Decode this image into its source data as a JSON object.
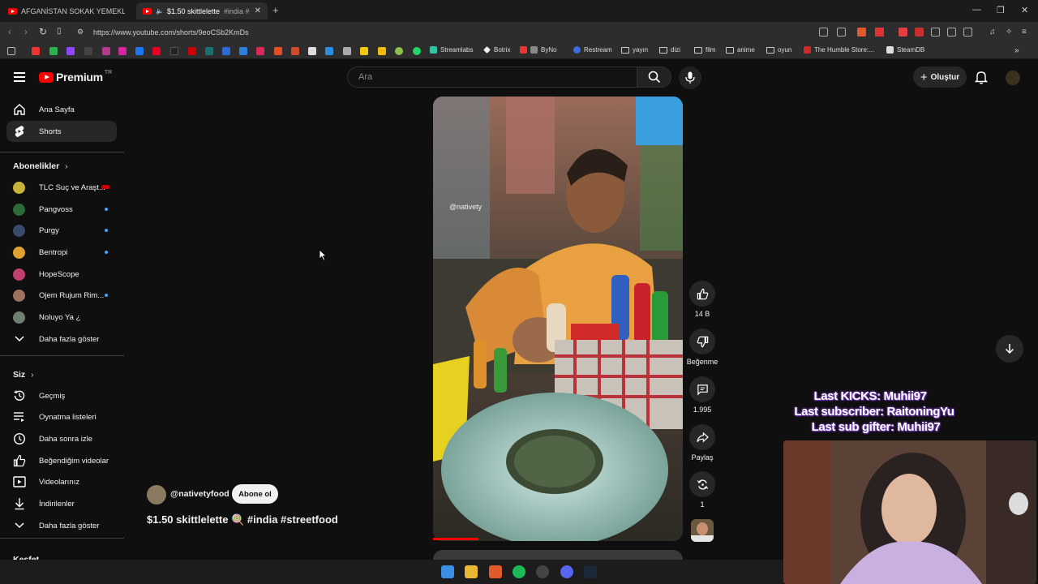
{
  "browser": {
    "tabs": [
      {
        "title": "AFGANİSTAN SOKAK YEMEKLERİNE",
        "active": false
      },
      {
        "title": "$1.50 skittlelette",
        "suffix": "#india #",
        "active": true
      }
    ],
    "url": "https://www.youtube.com/shorts/9eoCSb2KmDs",
    "bookmarks": [
      "Streamlabs",
      "Botrix",
      "ByNo",
      "Restream",
      "yayın",
      "dizi",
      "film",
      "anime",
      "oyun",
      "The Humble Store:...",
      "SteamDB"
    ]
  },
  "header": {
    "logo": "Premium",
    "region": "TR",
    "search_placeholder": "Ara",
    "create_label": "Oluştur"
  },
  "sidebar": {
    "main": [
      {
        "label": "Ana Sayfa",
        "icon": "home-icon",
        "active": false
      },
      {
        "label": "Shorts",
        "icon": "shorts-icon",
        "active": true
      }
    ],
    "subscriptions_title": "Abonelikler",
    "subscriptions": [
      {
        "label": "TLC Suç ve Araşt...",
        "color": "#c9b23a",
        "live": true
      },
      {
        "label": "Pangvoss",
        "color": "#2d6a3a",
        "dot": true
      },
      {
        "label": "Purgy",
        "color": "#3a4a6a",
        "dot": true
      },
      {
        "label": "Bentropi",
        "color": "#e0a030",
        "dot": true
      },
      {
        "label": "HopeScope",
        "color": "#c04070",
        "dot": false
      },
      {
        "label": "Ojem Rujum Rim...",
        "color": "#a07060",
        "dot": true
      },
      {
        "label": "Noluyo Ya ¿",
        "color": "#708070",
        "dot": false
      }
    ],
    "show_more": "Daha fazla göster",
    "you_title": "Siz",
    "you": [
      {
        "label": "Geçmiş",
        "icon": "history-icon"
      },
      {
        "label": "Oynatma listeleri",
        "icon": "playlists-icon"
      },
      {
        "label": "Daha sonra izle",
        "icon": "watch-later-icon"
      },
      {
        "label": "Beğendiğim videolar",
        "icon": "liked-icon"
      },
      {
        "label": "Videolarınız",
        "icon": "your-videos-icon"
      },
      {
        "label": "İndirilenler",
        "icon": "downloads-icon"
      },
      {
        "label": "Daha fazla göster",
        "icon": "chevron-down-icon"
      }
    ],
    "explore_title": "Keşfet"
  },
  "short": {
    "watermark": "@nativety",
    "channel": "@nativetyfood",
    "subscribe_label": "Abone ol",
    "title": "$1.50 skittlelette 🍭 #india #streetfood",
    "likes": "14 B",
    "dislike_label": "Beğenme",
    "comments": "1.995",
    "share_label": "Paylaş",
    "remix": "1"
  },
  "stream_overlay": {
    "last_kicks": "Last KICKS: Muhii97",
    "last_subscriber": "Last subscriber: RaitoningYu",
    "last_sub_gifter": "Last sub gifter: Muhii97"
  }
}
